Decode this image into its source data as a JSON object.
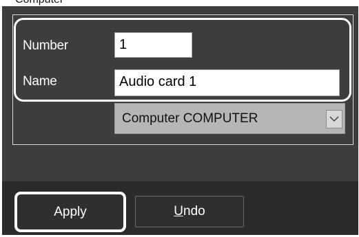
{
  "top_clipped_text": "Computer",
  "form": {
    "number_label": "Number",
    "number_value": "1",
    "name_label": "Name",
    "name_value": "Audio card 1",
    "computer_value": "Computer COMPUTER"
  },
  "icons": {
    "dropdown": "chevron-down-icon"
  },
  "buttons": {
    "apply_label": "Apply",
    "undo_mnemonic": "U",
    "undo_rest": "ndo"
  },
  "colors": {
    "panel_bg": "#3d3d3d",
    "footer_bg": "#2b2b2b",
    "highlight": "#ffffff"
  }
}
